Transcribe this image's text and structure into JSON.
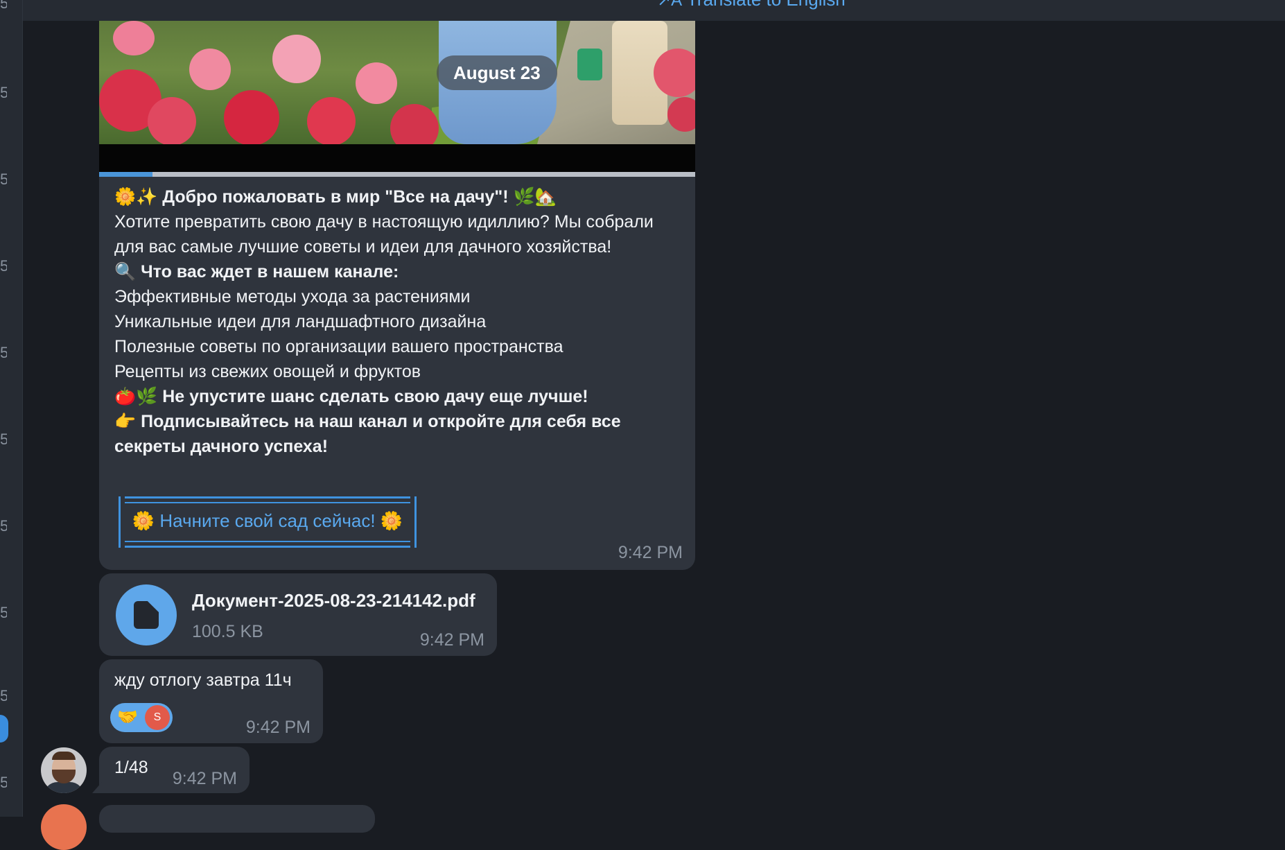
{
  "topbar": {
    "translate_icon": "translate-icon",
    "translate_icon_glyph": "↗A",
    "translate_label": "Translate to English"
  },
  "left_strip": {
    "tick_glyph": "5"
  },
  "date_separator": "August 23",
  "post": {
    "media": {
      "progress_fraction": 0.09
    },
    "heading_emojis": "🌼✨",
    "heading_text": "Добро пожаловать в мир \"Все на дачу\"!",
    "heading_tail_emojis": "🌿🏡",
    "intro": "Хотите превратить свою дачу в настоящую идиллию? Мы собрали для вас самые лучшие советы и идеи для дачного хозяйства!",
    "section_emoji": "🔍",
    "section_title": "Что вас ждет в нашем канале:",
    "list_items": [
      "Эффективные методы ухода за растениями",
      "Уникальные идеи для ландшафтного дизайна",
      "Полезные советы по организации вашего пространства",
      "Рецепты из свежих овощей и фруктов"
    ],
    "cta_line1_emojis": "🍅🌿",
    "cta_line1": "Не упустите шанс сделать свою дачу еще лучше!",
    "cta_line2_emoji": "👉",
    "cta_line2": "Подписывайтесь на наш канал и откройте для себя все секреты дачного успеха!",
    "button_label": "🌼 Начните свой сад сейчас! 🌼",
    "time": "9:42 PM"
  },
  "file_message": {
    "icon": "document-icon",
    "file_name": "Документ-2025-08-23-214142.pdf",
    "file_size": "100.5 KB",
    "time": "9:42 PM"
  },
  "text_message": {
    "text": "жду отлогу завтра 11ч",
    "reaction_emoji": "🤝",
    "reaction_user_initial": "S",
    "time": "9:42 PM"
  },
  "count_message": {
    "text": "1/48",
    "time": "9:42 PM"
  },
  "colors": {
    "background": "#191c22",
    "bubble": "#2f343d",
    "accent": "#5aa9ef",
    "progress": "#4a95d8"
  }
}
